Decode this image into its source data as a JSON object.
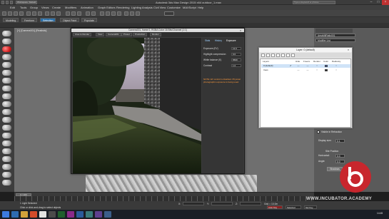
{
  "window": {
    "title": "Autodesk 3ds Max Design 2015 x64    outdoor_1.max",
    "workspace": "Workspace: Default",
    "search_placeholder": "Type a keyword or phrase"
  },
  "menubar": {
    "items": [
      "Edit",
      "Tools",
      "Group",
      "Views",
      "Create",
      "Modifiers",
      "Animation",
      "Graph Editors",
      "Rendering",
      "Lighting Analysis",
      "Civil View",
      "Customize",
      "MAXScript",
      "Help"
    ]
  },
  "ribbon": {
    "tabs": [
      "Modeling",
      "Freeform",
      "Selection",
      "Object Paint",
      "Populate"
    ],
    "active_tab": "Selection"
  },
  "viewport": {
    "label": "[+] [Camera001] [Realistic]"
  },
  "frame_buffer": {
    "title": "Camera001, frame 0, RGBA Color 16 Bits/Channel (1:1)",
    "toolbar": [
      "Area to Render",
      "View",
      "Camera001",
      "Preset",
      "Production",
      "Render"
    ],
    "side_tabs": [
      "Stats",
      "History",
      "Exposure"
    ],
    "params": [
      {
        "label": "Exposure (EV)",
        "value": "12.0"
      },
      {
        "label": "Highlight compression",
        "value": "0.0"
      },
      {
        "label": "White balance (K)",
        "value": "6500"
      },
      {
        "label": "Contrast",
        "value": "1.0"
      }
    ],
    "note": "NOTE: EV control is disabled. Physical photographic exposure is being used."
  },
  "layer_dialog": {
    "title": "Layer: 0 (default)",
    "columns": [
      "Layers",
      "Hide",
      "Freeze",
      "Render",
      "Color",
      "Radiosity"
    ],
    "rows": [
      {
        "name": "0 (default)",
        "checked": "✔",
        "color": "#3a63c8",
        "selected": true
      },
      {
        "name": "trees",
        "checked": "",
        "color": "#2a2a2a",
        "selected": false
      }
    ]
  },
  "command_panel": {
    "object_name": "AreaMtlRatio001",
    "modifier_list": "Modifier List",
    "visible_in_reflection": "Visible in Refraction",
    "display_size_label": "Display size:",
    "display_size": "0.1",
    "site_position": "Site Position",
    "horizontal_label": "Horizontal:",
    "horizontal_value": "0.0",
    "shadows_label": "Shadows",
    "angle_label": "Angle:",
    "angle_value": "0.0"
  },
  "timeline": {
    "slider": "0 / 100",
    "ticks": [
      "0",
      "10",
      "20",
      "30",
      "40",
      "50",
      "60",
      "70",
      "80",
      "90",
      "100"
    ]
  },
  "statusbar": {
    "selection": "1 Light Selected",
    "prompt": "Click or click-and-drag to select objects",
    "x": "X:",
    "y": "Y:",
    "z": "Z:",
    "grid": "Grid = 10.0m",
    "auto_key": "Auto Key",
    "set_key": "Set Key",
    "selected": "Selected",
    "time": "14:45"
  },
  "watermark": {
    "text": "WWW.INCUBATOR.ACADEMY"
  }
}
